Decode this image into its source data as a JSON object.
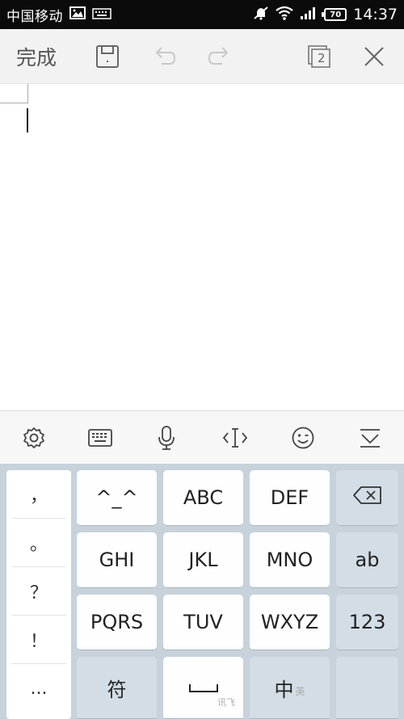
{
  "status_bar": {
    "carrier": "中国移动",
    "battery": "70",
    "time": "14:37"
  },
  "toolbar": {
    "done_label": "完成",
    "page_count": "2"
  },
  "keyboard": {
    "symbols": [
      "，",
      "。",
      "？",
      "！",
      "..."
    ],
    "rows": [
      [
        "^_^",
        "ABC",
        "DEF"
      ],
      [
        "GHI",
        "JKL",
        "MNO"
      ],
      [
        "PQRS",
        "TUV",
        "WXYZ"
      ]
    ],
    "side_keys": {
      "ab": "ab",
      "num": "123"
    },
    "bottom": {
      "symbol_key": "符",
      "space_brand": "讯飞",
      "lang_key": "中",
      "lang_alt": "英"
    }
  }
}
